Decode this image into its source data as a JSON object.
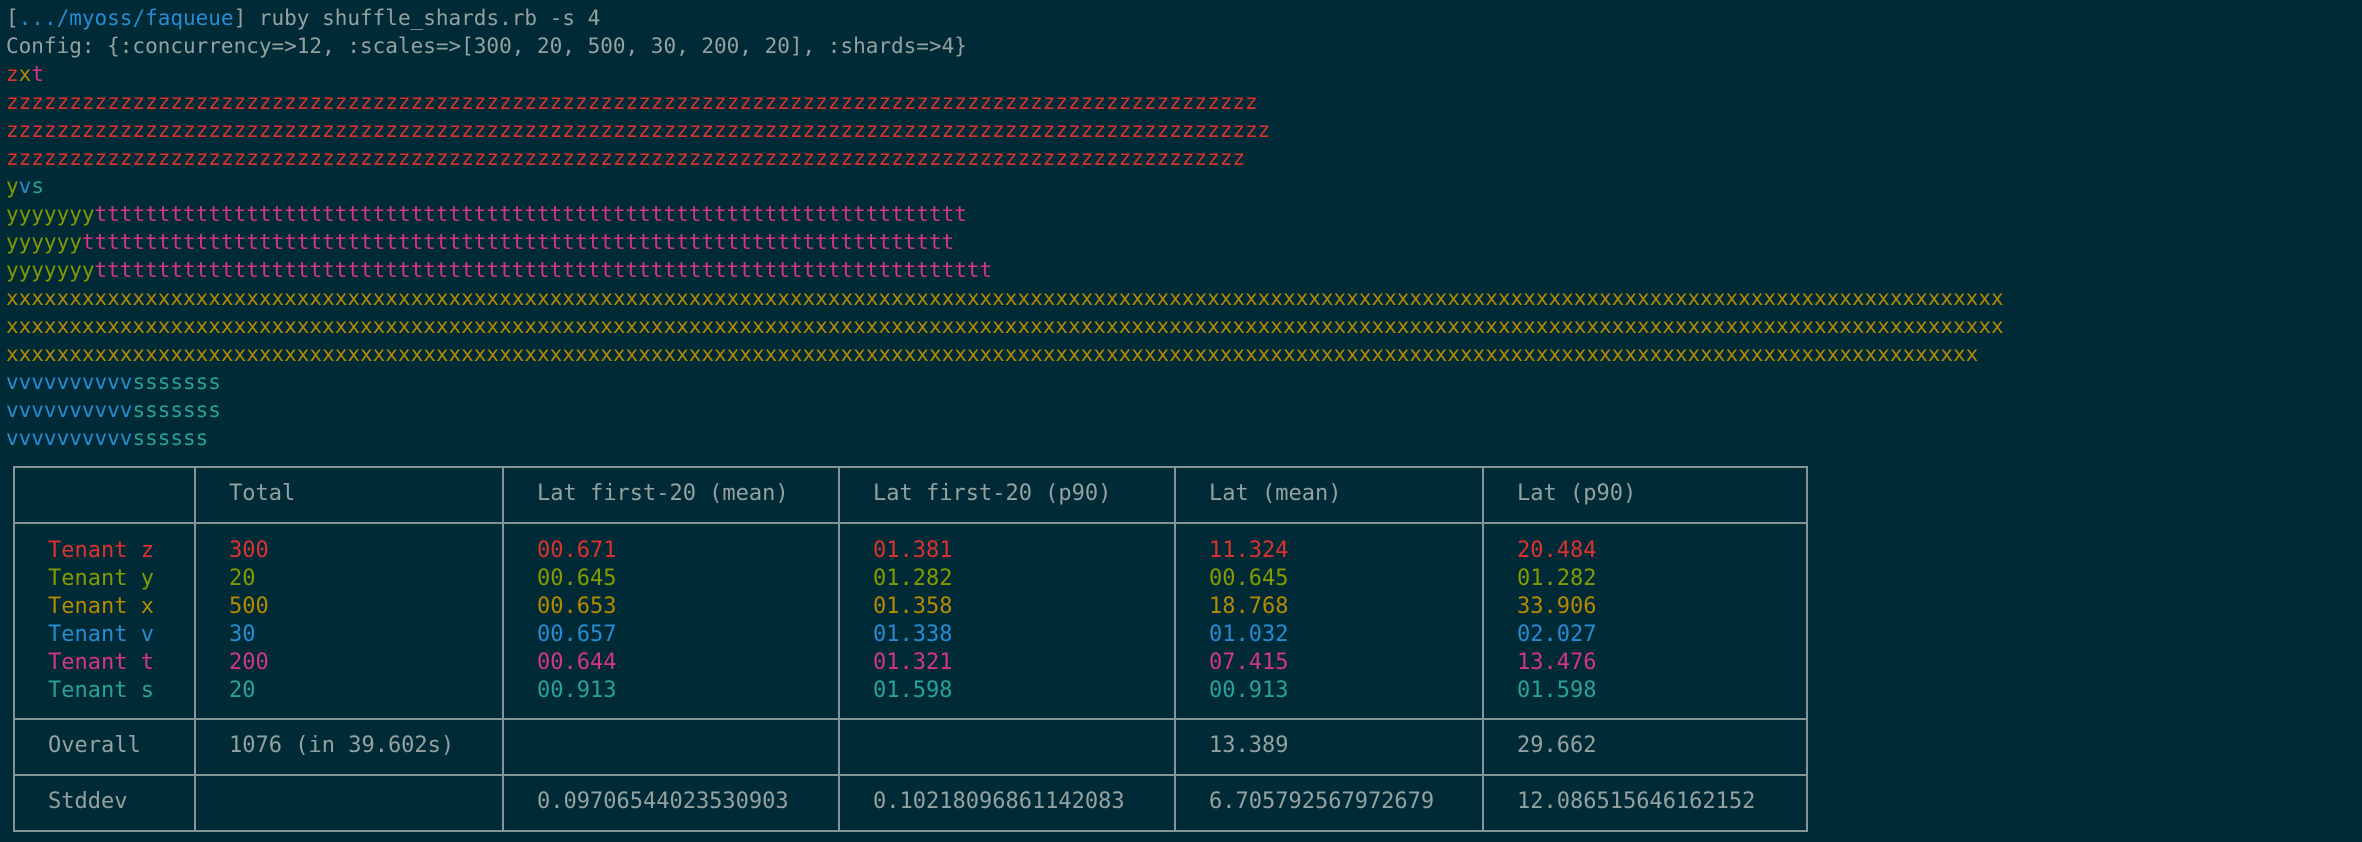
{
  "colors": {
    "background": "#002b36",
    "default": "#93a1a1",
    "blue": "#268bd2",
    "red": "#dc322f",
    "olive": "#859900",
    "yellow": "#b58900",
    "magenta": "#d33682",
    "cyan": "#2aa198",
    "border": "#839496"
  },
  "prompt": {
    "open_bracket": "[",
    "path": ".../myoss/faqueue",
    "close_and_command": "] ruby shuffle_shards.rb -s 4"
  },
  "config_line": "Config: {:concurrency=>12, :scales=>[300, 20, 500, 30, 200, 20], :shards=>4}",
  "shard_blocks": [
    {
      "header": [
        {
          "text": "z",
          "color": "red"
        },
        {
          "text": "x",
          "color": "yellow"
        },
        {
          "text": "t",
          "color": "magenta"
        }
      ],
      "rows": [
        [
          {
            "text": "zzzzzzzzzzzzzzzzzzzzzzzzzzzzzzzzzzzzzzzzzzzzzzzzzzzzzzzzzzzzzzzzzzzzzzzzzzzzzzzzzzzzzzzzzzzzzzzzzzz",
            "color": "red"
          }
        ],
        [
          {
            "text": "zzzzzzzzzzzzzzzzzzzzzzzzzzzzzzzzzzzzzzzzzzzzzzzzzzzzzzzzzzzzzzzzzzzzzzzzzzzzzzzzzzzzzzzzzzzzzzzzzzzz",
            "color": "red"
          }
        ],
        [
          {
            "text": "zzzzzzzzzzzzzzzzzzzzzzzzzzzzzzzzzzzzzzzzzzzzzzzzzzzzzzzzzzzzzzzzzzzzzzzzzzzzzzzzzzzzzzzzzzzzzzzzzz",
            "color": "red"
          }
        ]
      ]
    },
    {
      "header": [
        {
          "text": "y",
          "color": "olive"
        },
        {
          "text": "v",
          "color": "blue"
        },
        {
          "text": "s",
          "color": "cyan"
        }
      ],
      "rows": [
        [
          {
            "text": "yyyyyyy",
            "color": "olive"
          },
          {
            "text": "ttttttttttttttttttttttttttttttttttttttttttttttttttttttttttttttttttttt",
            "color": "magenta"
          }
        ],
        [
          {
            "text": "yyyyyy",
            "color": "olive"
          },
          {
            "text": "ttttttttttttttttttttttttttttttttttttttttttttttttttttttttttttttttttttt",
            "color": "magenta"
          }
        ],
        [
          {
            "text": "yyyyyyy",
            "color": "olive"
          },
          {
            "text": "ttttttttttttttttttttttttttttttttttttttttttttttttttttttttttttttttttttttt",
            "color": "magenta"
          }
        ]
      ]
    },
    {
      "header": [],
      "rows": [
        [
          {
            "text": "xxxxxxxxxxxxxxxxxxxxxxxxxxxxxxxxxxxxxxxxxxxxxxxxxxxxxxxxxxxxxxxxxxxxxxxxxxxxxxxxxxxxxxxxxxxxxxxxxxxxxxxxxxxxxxxxxxxxxxxxxxxxxxxxxxxxxxxxxxxxxxxxxxxxxxxxxxxxxx",
            "color": "yellow"
          }
        ],
        [
          {
            "text": "xxxxxxxxxxxxxxxxxxxxxxxxxxxxxxxxxxxxxxxxxxxxxxxxxxxxxxxxxxxxxxxxxxxxxxxxxxxxxxxxxxxxxxxxxxxxxxxxxxxxxxxxxxxxxxxxxxxxxxxxxxxxxxxxxxxxxxxxxxxxxxxxxxxxxxxxxxxxxx",
            "color": "yellow"
          }
        ],
        [
          {
            "text": "xxxxxxxxxxxxxxxxxxxxxxxxxxxxxxxxxxxxxxxxxxxxxxxxxxxxxxxxxxxxxxxxxxxxxxxxxxxxxxxxxxxxxxxxxxxxxxxxxxxxxxxxxxxxxxxxxxxxxxxxxxxxxxxxxxxxxxxxxxxxxxxxxxxxxxxxxxxx",
            "color": "yellow"
          }
        ]
      ]
    },
    {
      "header": [],
      "rows": [
        [
          {
            "text": "vvvvvvvvvv",
            "color": "blue"
          },
          {
            "text": "sssssss",
            "color": "cyan"
          }
        ],
        [
          {
            "text": "vvvvvvvvvv",
            "color": "blue"
          },
          {
            "text": "sssssss",
            "color": "cyan"
          }
        ],
        [
          {
            "text": "vvvvvvvvvv",
            "color": "blue"
          },
          {
            "text": "ssssss",
            "color": "cyan"
          }
        ]
      ]
    }
  ],
  "table": {
    "headers": [
      "",
      "Total",
      "Lat first-20 (mean)",
      "Lat first-20 (p90)",
      "Lat (mean)",
      "Lat (p90)"
    ],
    "tenants": [
      {
        "name": "Tenant z",
        "color": "red",
        "total": "300",
        "first20_mean": "00.671",
        "first20_p90": "01.381",
        "mean": "11.324",
        "p90": "20.484"
      },
      {
        "name": "Tenant y",
        "color": "olive",
        "total": "20",
        "first20_mean": "00.645",
        "first20_p90": "01.282",
        "mean": "00.645",
        "p90": "01.282"
      },
      {
        "name": "Tenant x",
        "color": "yellow",
        "total": "500",
        "first20_mean": "00.653",
        "first20_p90": "01.358",
        "mean": "18.768",
        "p90": "33.906"
      },
      {
        "name": "Tenant v",
        "color": "blue",
        "total": "30",
        "first20_mean": "00.657",
        "first20_p90": "01.338",
        "mean": "01.032",
        "p90": "02.027"
      },
      {
        "name": "Tenant t",
        "color": "magenta",
        "total": "200",
        "first20_mean": "00.644",
        "first20_p90": "01.321",
        "mean": "07.415",
        "p90": "13.476"
      },
      {
        "name": "Tenant s",
        "color": "cyan",
        "total": "20",
        "first20_mean": "00.913",
        "first20_p90": "01.598",
        "mean": "00.913",
        "p90": "01.598"
      }
    ],
    "overall": {
      "label": "Overall",
      "total": "1076 (in 39.602s)",
      "first20_mean": "",
      "first20_p90": "",
      "mean": "13.389",
      "p90": "29.662"
    },
    "stddev": {
      "label": "Stddev",
      "total": "",
      "first20_mean": "0.09706544023530903",
      "first20_p90": "0.10218096861142083",
      "mean": "6.705792567972679",
      "p90": "12.086515646162152"
    }
  }
}
